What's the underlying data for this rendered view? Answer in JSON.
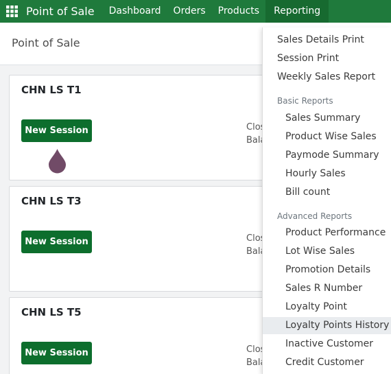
{
  "navbar": {
    "brand": "Point of Sale",
    "menu": [
      "Dashboard",
      "Orders",
      "Products",
      "Reporting"
    ]
  },
  "control_panel": {
    "title": "Point of Sale"
  },
  "cards": [
    {
      "name": "CHN LS T1",
      "button": "New Session",
      "meta1": "Clos",
      "meta2": "Bala"
    },
    {
      "name": "CHN LS T3",
      "button": "New Session",
      "meta1": "Clos",
      "meta2": "Bala"
    },
    {
      "name": "CHN LS T5",
      "button": "New Session",
      "meta1": "Clos",
      "meta2": "Bala"
    }
  ],
  "reporting_menu": {
    "top_items": [
      "Sales Details Print",
      "Session Print",
      "Weekly Sales Report"
    ],
    "basic_header": "Basic Reports",
    "basic_items": [
      "Sales Summary",
      "Product Wise Sales",
      "Paymode Summary",
      "Hourly Sales",
      "Bill count"
    ],
    "advanced_header": "Advanced Reports",
    "advanced_items": [
      "Product Performance",
      "Lot Wise Sales",
      "Promotion Details",
      "Sales R Number",
      "Loyalty Point",
      "Loyalty Points History",
      "Inactive Customer",
      "Credit Customer"
    ]
  },
  "colors": {
    "navbar": "#1f7a3c",
    "button": "#0d6e2d",
    "cursor_drop": "#714b67"
  }
}
